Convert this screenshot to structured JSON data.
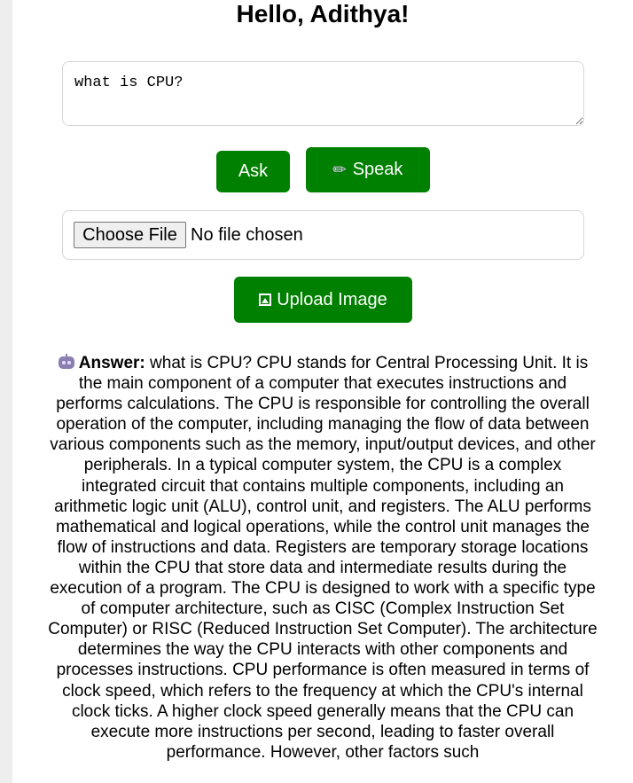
{
  "greeting": "Hello, Adithya!",
  "question": {
    "value": "what is CPU?"
  },
  "buttons": {
    "ask": "Ask",
    "speak": "Speak",
    "upload": "Upload Image"
  },
  "file_input": {
    "button_label": "Choose File",
    "status": "No file chosen"
  },
  "answer": {
    "label": "Answer:",
    "text": " what is CPU? CPU stands for Central Processing Unit. It is the main component of a computer that executes instructions and performs calculations. The CPU is responsible for controlling the overall operation of the computer, including managing the flow of data between various components such as the memory, input/output devices, and other peripherals. In a typical computer system, the CPU is a complex integrated circuit that contains multiple components, including an arithmetic logic unit (ALU), control unit, and registers. The ALU performs mathematical and logical operations, while the control unit manages the flow of instructions and data. Registers are temporary storage locations within the CPU that store data and intermediate results during the execution of a program. The CPU is designed to work with a specific type of computer architecture, such as CISC (Complex Instruction Set Computer) or RISC (Reduced Instruction Set Computer). The architecture determines the way the CPU interacts with other components and processes instructions. CPU performance is often measured in terms of clock speed, which refers to the frequency at which the CPU's internal clock ticks. A higher clock speed generally means that the CPU can execute more instructions per second, leading to faster overall performance. However, other factors such"
  },
  "icons": {
    "speak": "microphone-icon",
    "upload": "image-icon",
    "answer": "robot-icon"
  },
  "colors": {
    "button_bg": "#008000",
    "button_text": "#ffffff"
  }
}
